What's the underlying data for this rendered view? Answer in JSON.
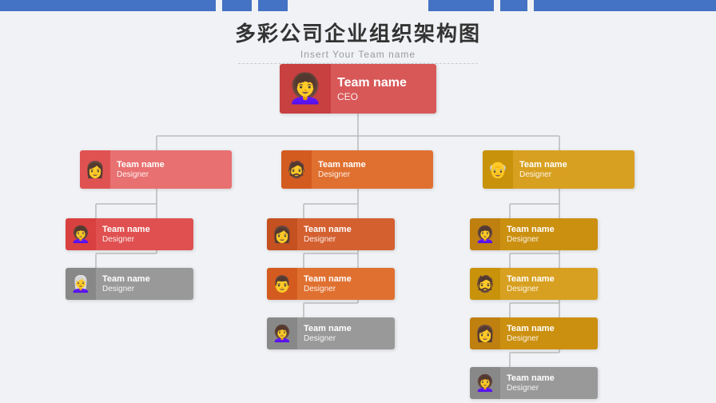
{
  "header": {
    "title": "多彩公司企业组织架构图",
    "subtitle": "Insert Your Team name"
  },
  "colors": {
    "blue": "#4472c4",
    "bg": "#f0f2f5",
    "red_dark": "#c84040",
    "red_light": "#e87070",
    "orange_dark": "#d45b20",
    "orange_light": "#e07030",
    "yellow_dark": "#c8920a",
    "yellow_light": "#d8a020",
    "gray_dark": "#888888",
    "gray_light": "#999999"
  },
  "nodes": {
    "ceo": {
      "name": "Team name",
      "role": "CEO",
      "avatar": "👩‍🦱"
    },
    "l1_left": {
      "name": "Team name",
      "role": "Designer",
      "avatar": "👩"
    },
    "l1_mid": {
      "name": "Team name",
      "role": "Designer",
      "avatar": "🧔"
    },
    "l1_right": {
      "name": "Team name",
      "role": "Designer",
      "avatar": "👴"
    },
    "l2_left_1": {
      "name": "Team name",
      "role": "Designer",
      "avatar": "👩‍🦱"
    },
    "l2_left_2": {
      "name": "Team name",
      "role": "Designer",
      "avatar": "👩‍🦳"
    },
    "l2_mid_1": {
      "name": "Team name",
      "role": "Designer",
      "avatar": "👩"
    },
    "l2_mid_2": {
      "name": "Team name",
      "role": "Designer",
      "avatar": "👨"
    },
    "l2_mid_3": {
      "name": "Team name",
      "role": "Designer",
      "avatar": "👩‍🦱"
    },
    "l2_right_1": {
      "name": "Team name",
      "role": "Designer",
      "avatar": "👩‍🦱"
    },
    "l2_right_2": {
      "name": "Team name",
      "role": "Designer",
      "avatar": "🧔"
    },
    "l2_right_3": {
      "name": "Team name",
      "role": "Designer",
      "avatar": "👩"
    },
    "l2_right_4": {
      "name": "Team name",
      "role": "Designer",
      "avatar": "👩‍🦱"
    }
  }
}
